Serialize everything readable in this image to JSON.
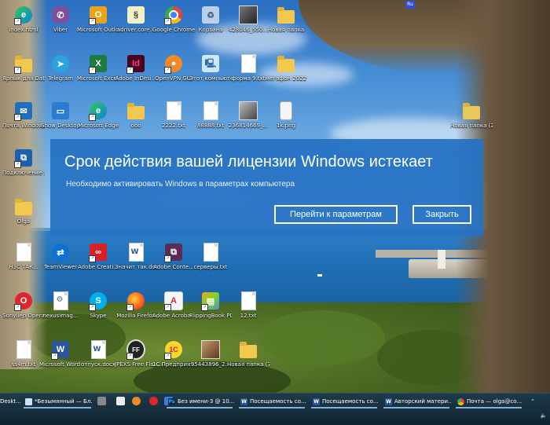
{
  "language_indicator": "Ru",
  "desktop_icons": [
    {
      "label": "index.html",
      "icon": "edge-icon"
    },
    {
      "label": "Viber",
      "icon": "viber-icon"
    },
    {
      "label": "Microsoft Outlook 2010",
      "icon": "outlook-icon"
    },
    {
      "label": "adriver.core...",
      "icon": "notepad-doc-icon"
    },
    {
      "label": "Google Chrome",
      "icon": "chrome-icon"
    },
    {
      "label": "Корзина",
      "icon": "recycle-bin-icon"
    },
    {
      "label": "428046_550...",
      "icon": "photo-icon"
    },
    {
      "label": "Новая папка",
      "icon": "folder-icon"
    },
    {
      "label": "Ярлык для Data на ...",
      "icon": "folder-shortcut-icon"
    },
    {
      "label": "Telegram",
      "icon": "telegram-icon"
    },
    {
      "label": "Microsoft Excel 2010",
      "icon": "excel-icon"
    },
    {
      "label": "Adobe InDesi...",
      "icon": "indesign-icon"
    },
    {
      "label": "OpenVPN GUI",
      "icon": "openvpn-icon"
    },
    {
      "label": "Этот компьютер",
      "icon": "computer-icon"
    },
    {
      "label": "форма 9.txt",
      "icon": "text-file-icon"
    },
    {
      "label": "мегафон 2022",
      "icon": "folder-icon"
    },
    {
      "label": "Почта Windows Live",
      "icon": "mail-icon"
    },
    {
      "label": "Show Desktop",
      "icon": "show-desktop-icon"
    },
    {
      "label": "Microsoft Edge",
      "icon": "edge-icon"
    },
    {
      "label": "ооо",
      "icon": "folder-icon"
    },
    {
      "label": "2222.txt",
      "icon": "text-file-icon"
    },
    {
      "label": "88888.txt",
      "icon": "text-file-icon"
    },
    {
      "label": "236814669_...",
      "icon": "photo-icon"
    },
    {
      "label": "1k.png",
      "icon": "image-file-icon"
    },
    {
      "label": "Новая папка (2)",
      "icon": "folder-icon"
    },
    {
      "label": "Подключение к удаленно...",
      "icon": "remote-desktop-icon"
    },
    {
      "label": "Olga",
      "icon": "folder-icon"
    },
    {
      "label": "НЗС ТАК...",
      "icon": "text-file-icon"
    },
    {
      "label": "TeamViewer",
      "icon": "teamviewer-icon"
    },
    {
      "label": "Adobe Creati...",
      "icon": "adobe-cc-icon"
    },
    {
      "label": "Значит так.docx",
      "icon": "word-doc-icon"
    },
    {
      "label": "Adobe Conte...",
      "icon": "adobe-content-icon"
    },
    {
      "label": "серверы.txt",
      "icon": "text-file-icon"
    },
    {
      "label": "Sonyliep Opera",
      "icon": "opera-icon"
    },
    {
      "label": "nexusimag...",
      "icon": "gear-file-icon"
    },
    {
      "label": "Skype",
      "icon": "skype-icon"
    },
    {
      "label": "Mozilla Firefox",
      "icon": "firefox-icon"
    },
    {
      "label": "Adobe Acrobat ...",
      "icon": "acrobat-icon"
    },
    {
      "label": "FlippingBook PDF Publisher",
      "icon": "flippingbook-icon"
    },
    {
      "label": "12.txt",
      "icon": "text-file-icon"
    },
    {
      "label": "ss4m.txt",
      "icon": "text-file-icon"
    },
    {
      "label": "Microsoft Word 2010",
      "icon": "word-icon"
    },
    {
      "label": "отпуск.docx",
      "icon": "word-doc-icon"
    },
    {
      "label": "JPEXS Free Flash Dec...",
      "icon": "jpexs-icon"
    },
    {
      "label": "1С Предприят...",
      "icon": "1c-icon"
    },
    {
      "label": "95443896_2...",
      "icon": "photo-icon"
    },
    {
      "label": "Новая папка (7)",
      "icon": "folder-icon"
    }
  ],
  "notification": {
    "title": "Срок действия вашей лицензии Windows истекает",
    "message": "Необходимо активировать Windows в параметрах компьютера",
    "settings_button": "Перейти к параметрам",
    "close_button": "Закрыть"
  },
  "taskbar": {
    "items": [
      {
        "label": "Deskt...",
        "icon": "desktop-icon"
      },
      {
        "label": "*Безымянный — Бл...",
        "icon": "notepad-icon"
      },
      {
        "label": "",
        "icon": "gear-icon"
      },
      {
        "label": "",
        "icon": "app-icon"
      },
      {
        "label": "",
        "icon": "orange-app-icon"
      },
      {
        "label": "",
        "icon": "opera-icon"
      },
      {
        "label": "",
        "icon": "windows-icon"
      },
      {
        "label": "Без имени-3 @ 10...",
        "icon": "photoshop-icon"
      },
      {
        "label": "Посещаемость со...",
        "icon": "word-icon"
      },
      {
        "label": "Посещаемость со...",
        "icon": "word-icon"
      },
      {
        "label": "Авторский матери...",
        "icon": "word-icon"
      },
      {
        "label": "Почта — olga@co...",
        "icon": "chrome-icon"
      }
    ],
    "tray": {
      "volume_icon": "volume-icon",
      "chevron": "chevron-up-icon"
    }
  },
  "colors": {
    "notification_bg": "#2672c4",
    "taskbar_bg": "#132c3a"
  }
}
